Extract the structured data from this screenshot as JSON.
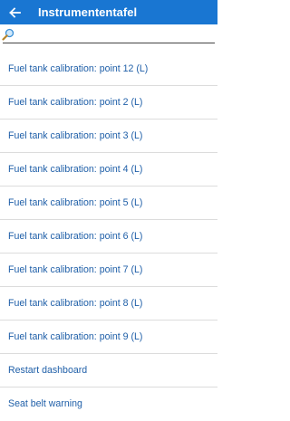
{
  "header": {
    "title": "Instrumententafel",
    "background": "#1976d2",
    "back_icon": "arrow-left-icon"
  },
  "search": {
    "value": "",
    "placeholder": "",
    "icon": "magnifier-icon"
  },
  "list": {
    "text_color": "#1f5fa8",
    "items": [
      {
        "label": "Fuel tank calibration: point 12 (L)"
      },
      {
        "label": "Fuel tank calibration: point 2 (L)"
      },
      {
        "label": "Fuel tank calibration: point 3 (L)"
      },
      {
        "label": "Fuel tank calibration: point 4 (L)"
      },
      {
        "label": "Fuel tank calibration: point 5 (L)"
      },
      {
        "label": "Fuel tank calibration: point 6 (L)"
      },
      {
        "label": "Fuel tank calibration: point 7 (L)"
      },
      {
        "label": "Fuel tank calibration: point 8 (L)"
      },
      {
        "label": "Fuel tank calibration: point 9 (L)"
      },
      {
        "label": "Restart dashboard"
      },
      {
        "label": "Seat belt warning"
      }
    ]
  }
}
